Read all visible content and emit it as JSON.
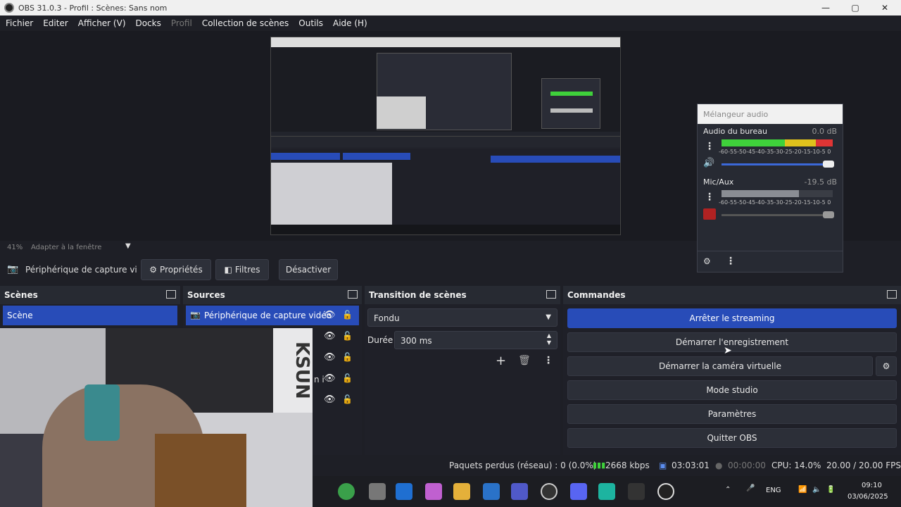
{
  "window": {
    "title": "OBS 31.0.3 - Profil : Scènes: Sans nom",
    "minimize": "—",
    "maximize": "▢",
    "close": "✕"
  },
  "menu": [
    "Fichier",
    "Editer",
    "Afficher (V)",
    "Docks",
    "Profil",
    "Collection de scènes",
    "Outils",
    "Aide (H)"
  ],
  "zoom": {
    "value": "41%",
    "mode": "Adapter à la fenêtre"
  },
  "source_toolbar": {
    "source_name": "Périphérique de capture vi",
    "properties": "Propriétés",
    "filters": "Filtres",
    "deactivate": "Désactiver"
  },
  "mixer": {
    "title": "Mélangeur audio",
    "channels": [
      {
        "name": "Audio du bureau",
        "db": "0.0 dB"
      },
      {
        "name": "Mic/Aux",
        "db": "-19.5 dB"
      }
    ],
    "scale": "-60-55-50-45-40-35-30-25-20-15-10-5 0"
  },
  "scenes": {
    "header": "Scènes",
    "items": [
      "Scène"
    ]
  },
  "sources": {
    "header": "Sources",
    "items": [
      "Périphérique de capture vidéo"
    ],
    "partial_label": "n i"
  },
  "transition": {
    "header": "Transition de scènes",
    "type": "Fondu",
    "duration_label": "Durée",
    "duration_value": "300 ms"
  },
  "commands": {
    "header": "Commandes",
    "stop_streaming": "Arrêter le streaming",
    "start_recording": "Démarrer l'enregistrement",
    "start_virtualcam": "Démarrer la caméra virtuelle",
    "studio_mode": "Mode studio",
    "settings": "Paramètres",
    "quit": "Quitter OBS"
  },
  "status": {
    "dropped": "Paquets perdus (réseau) : 0 (0.0%)",
    "bitrate": "2668 kbps",
    "stream_time": "03:03:01",
    "rec_time": "00:00:00",
    "cpu": "CPU: 14.0%",
    "fps": "20.00 / 20.00 FPS"
  },
  "tray": {
    "lang": "ENG",
    "time": "09:10",
    "date": "03/06/2025"
  },
  "preview_watermark": "KSUN"
}
